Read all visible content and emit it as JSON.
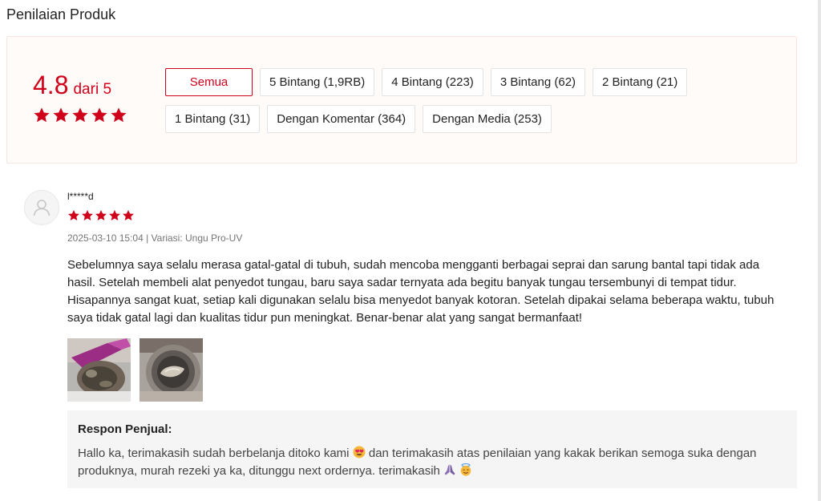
{
  "page": {
    "title": "Penilaian Produk"
  },
  "summary": {
    "rating": "4.8",
    "rating_suffix": "dari 5",
    "stars": 5,
    "filters": [
      {
        "label": "Semua",
        "active": true
      },
      {
        "label": "5 Bintang (1,9RB)",
        "active": false
      },
      {
        "label": "4 Bintang (223)",
        "active": false
      },
      {
        "label": "3 Bintang (62)",
        "active": false
      },
      {
        "label": "2 Bintang (21)",
        "active": false
      },
      {
        "label": "1 Bintang (31)",
        "active": false
      },
      {
        "label": "Dengan Komentar (364)",
        "active": false
      },
      {
        "label": "Dengan Media (253)",
        "active": false
      }
    ]
  },
  "review": {
    "username": "l*****d",
    "stars": 5,
    "meta": "2025-03-10 15:04 | Variasi: Ungu Pro-UV",
    "comment": "Sebelumnya saya selalu merasa gatal-gatal di tubuh, sudah mencoba mengganti berbagai seprai dan sarung bantal tapi tidak ada hasil. Setelah membeli alat penyedot tungau, baru saya sadar ternyata ada begitu banyak tungau tersembunyi di tempat tidur. Hisapannya sangat kuat, setiap kali digunakan selalu bisa menyedot banyak kotoran. Setelah dipakai selama beberapa waktu, tubuh saya tidak gatal lagi dan kualitas tidur pun meningkat. Benar-benar alat yang sangat bermanfaat!",
    "media_count": 2,
    "seller_title": "Respon Penjual:",
    "seller_text_1": "Hallo ka, terimakasih sudah berbelanja ditoko kami",
    "seller_text_2": " dan terimakasih atas penilaian yang kakak berikan semoga suka dengan produknya, murah rezeki ya ka, ditunggu next ordernya. terimakasih"
  },
  "colors": {
    "accent": "#d0011b",
    "summary_bg": "#fffbf8",
    "seller_bg": "#f5f5f5"
  },
  "icons": {
    "avatar": "user-avatar-icon",
    "star": "star-icon",
    "emoji_1": "heart-eyes-emoji-icon",
    "emoji_2": "praying-hands-emoji-icon",
    "emoji_3": "smiling-angel-emoji-icon"
  }
}
